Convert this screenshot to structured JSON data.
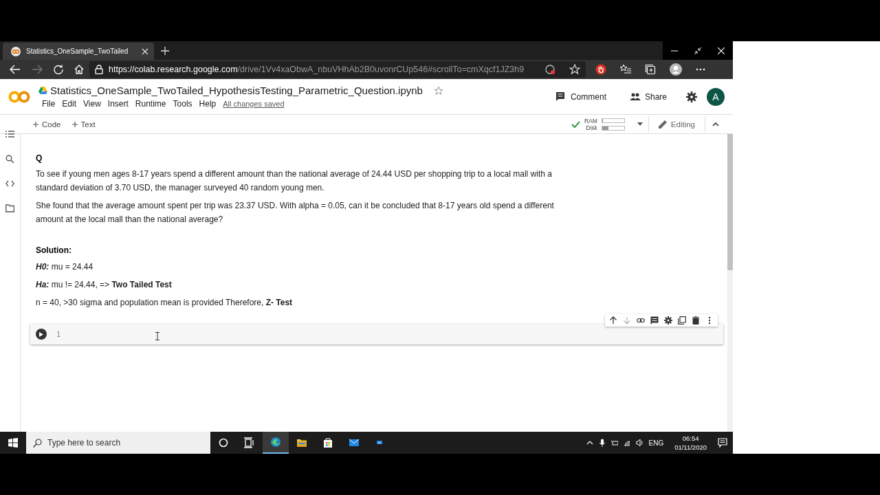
{
  "browser": {
    "tab_title": "Statistics_OneSample_TwoTailed",
    "url_host": "https://colab.research.google.com",
    "url_path": "/drive/1Vv4xaObwA_nbuVHhAb2B0uvonrCUp546#scrollTo=cmXqcf1JZ3h9"
  },
  "notebook": {
    "title": "Statistics_OneSample_TwoTailed_HypothesisTesting_Parametric_Question.ipynb",
    "menu": [
      "File",
      "Edit",
      "View",
      "Insert",
      "Runtime",
      "Tools",
      "Help"
    ],
    "save_status": "All changes saved",
    "actions": [
      "Comment",
      "Share"
    ],
    "avatar": "A"
  },
  "toolbar": {
    "add_buttons": [
      "Code",
      "Text"
    ],
    "connected": true,
    "meters": [
      {
        "label": "RAM",
        "level": 0.05
      },
      {
        "label": "Disk",
        "level": 0.3
      }
    ],
    "mode": "Editing"
  },
  "text_cell": {
    "heading": "Q",
    "paragraphs": [
      "To see if young men ages 8-17 years spend a different amount than the national average of 24.44 USD per shopping trip to a local mall with a standard deviation of 3.70 USD, the manager surveyed 40 random young men.",
      "She found that the average amount spent per trip was 23.37 USD. With alpha = 0.05, can it be concluded that 8-17 years old spend a different amount at the local mall than the national average?"
    ],
    "solution_heading": "Solution:",
    "lines": [
      {
        "label": "H0:",
        "text": "mu = 24.44"
      },
      {
        "label": "Ha:",
        "text": "mu != 24.44, => **Two Tailed Test**"
      },
      {
        "text": "n = 40, >30 sigma and population mean is provided Therefore, **Z- Test**"
      }
    ]
  },
  "code_cell": {
    "line_numbers": [
      "1"
    ]
  },
  "taskbar": {
    "search_placeholder": "Type here to search",
    "language": "ENG",
    "time": "06:54",
    "date": "01/11/2020"
  }
}
